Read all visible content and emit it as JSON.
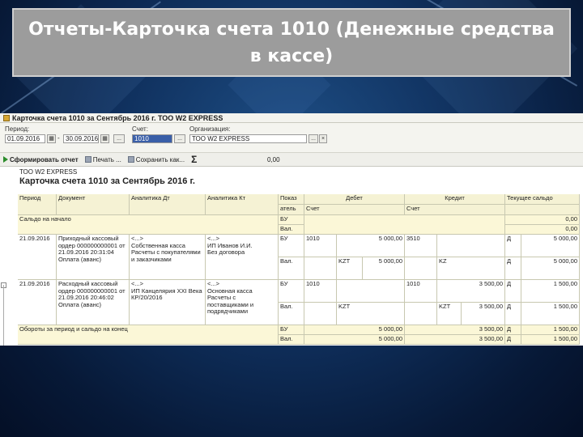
{
  "slide_title": "Отчеты-Карточка счета 1010 (Денежные средства в кассе)",
  "window": {
    "title": "Карточка счета 1010 за Сентябрь 2016 г. ТОО W2 EXPRESS"
  },
  "filters": {
    "period_label": "Период:",
    "date_from": "01.09.2016",
    "date_to": "30.09.2016",
    "ellipsis": "...",
    "account_label": "Счет:",
    "account_value": "1010",
    "org_label": "Организация:",
    "org_value": "ТОО W2 EXPRESS"
  },
  "toolbar": {
    "generate": "Сформировать отчет",
    "print": "Печать ...",
    "save": "Сохранить как...",
    "sigma": "Σ",
    "sum_value": "0,00"
  },
  "report": {
    "org": "ТОО W2 EXPRESS",
    "title": "Карточка счета 1010 за Сентябрь 2016 г.",
    "headers": {
      "period": "Период",
      "document": "Документ",
      "analytics_dt": "Аналитика Дт",
      "analytics_kt": "Аналитика Кт",
      "indicator_top": "Показ",
      "indicator_bottom": "атель",
      "debit": "Дебет",
      "credit": "Кредит",
      "balance": "Текущее сальдо",
      "account": "Счет",
      "account2": "Счет"
    },
    "opening": {
      "label": "Сальдо на начало",
      "ind1": "БУ",
      "ind2": "Вал.",
      "v1": "0,00",
      "v2": "0,00"
    },
    "rows": [
      {
        "period": "21.09.2016",
        "document": "Приходный кассовый ордер 000000000001 от 21.09.2016 20:31:04 Оплата (аванс)",
        "analytics_dt": "<...>\nСобственная касса\nРасчеты с покупателями и заказчиками",
        "analytics_kt": "<...>\nИП Иванов И.И.\nБез договора",
        "ind1": "БУ",
        "ind2": "Вал.",
        "debit_account": "1010",
        "debit_amount": "5 000,00",
        "credit_account": "3510",
        "dt_currency": "KZT",
        "dt_currency_amount": "5 000,00",
        "kt_currency": "KZ",
        "balance_mark1": "Д",
        "balance1": "5 000,00",
        "balance_mark2": "Д",
        "balance2": "5 000,00"
      },
      {
        "period": "21.09.2016",
        "document": "Расходный кассовый ордер 000000000001 от 21.09.2016 20:46:02 Оплата (аванс)",
        "analytics_dt": "<...>\nИП Канцелярия XXI Века\nКР/20/2016",
        "analytics_kt": "<...>\nОсновная касса\nРасчеты с поставщиками и подрядчиками",
        "ind1": "БУ",
        "ind2": "Вал.",
        "debit_account": "1010",
        "credit_account": "1010",
        "credit_amount": "3 500,00",
        "dt_currency": "KZT",
        "kt_currency": "KZT",
        "kt_currency_amount": "3 500,00",
        "balance_mark1": "Д",
        "balance1": "1 500,00",
        "balance_mark2": "Д",
        "balance2": "1 500,00"
      }
    ],
    "totals": {
      "label": "Обороты за период и сальдо на конец",
      "ind1": "БУ",
      "ind2": "Вал.",
      "debit1": "5 000,00",
      "debit2": "5 000,00",
      "credit1": "3 500,00",
      "credit2": "3 500,00",
      "mark1": "Д",
      "mark2": "Д",
      "balance1": "1 500,00",
      "balance2": "1 500,00"
    }
  }
}
